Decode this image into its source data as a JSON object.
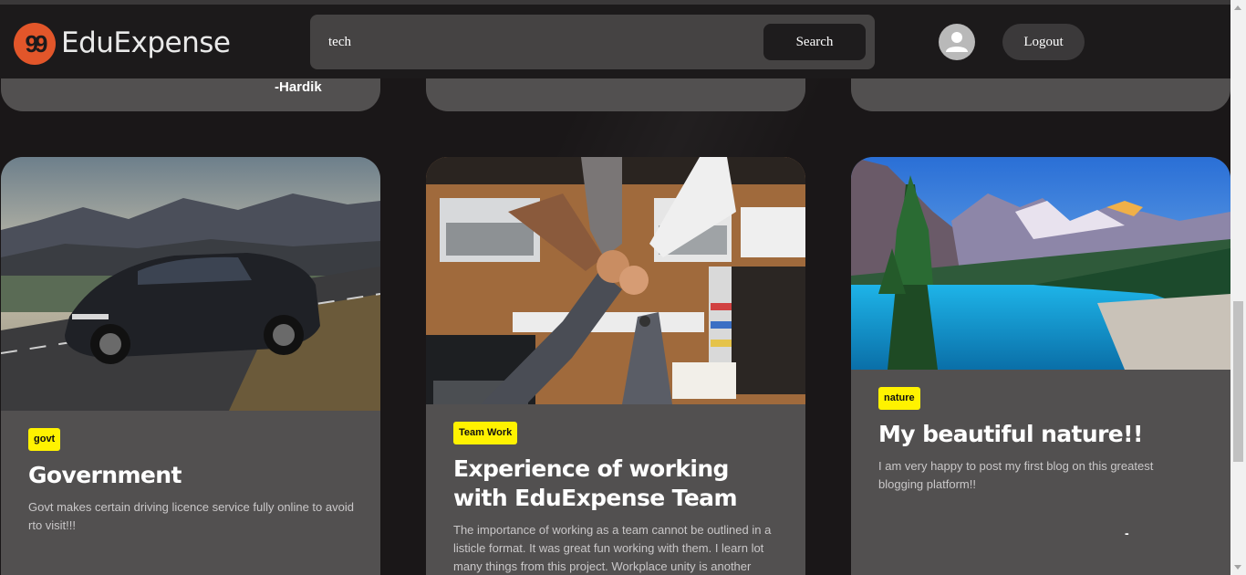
{
  "navbar": {
    "brand": "EduExpense",
    "logo_glyph": "99",
    "search_value": "tech",
    "search_button": "Search",
    "logout_button": "Logout"
  },
  "top_cards": [
    {
      "author": "-Hardik"
    },
    {
      "author": ""
    },
    {
      "author": ""
    }
  ],
  "cards": [
    {
      "tag": "govt",
      "title": "Government",
      "description": "Govt makes certain driving licence service fully online to avoid rto visit!!!"
    },
    {
      "tag": "Team Work",
      "title": "Experience of working with EduExpense Team",
      "description": "The importance of working as a team cannot be outlined in a listicle format. It was great fun working with them. I learn lot many things from this project. Workplace unity is another"
    },
    {
      "tag": "nature",
      "title": "My beautiful nature!!",
      "description": "I am very happy to post my first blog on this greatest blogging platform!!",
      "author": "-"
    }
  ],
  "colors": {
    "background": "#1a1718",
    "card": "#525050",
    "tag": "#fff200",
    "logo": "#e2562a"
  }
}
